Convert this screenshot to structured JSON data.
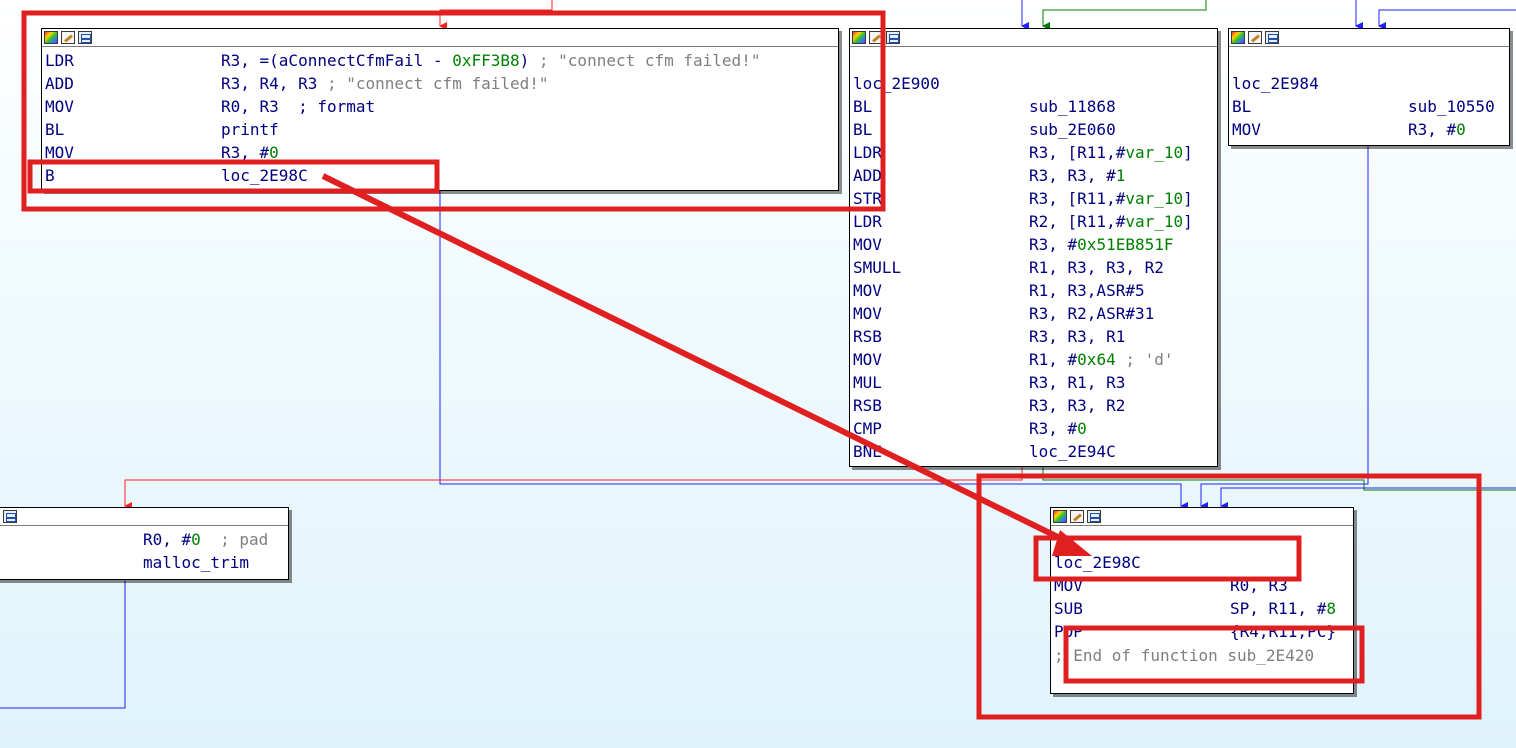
{
  "colors": {
    "mnemonic": "#000080",
    "immediate": "#008000",
    "comment": "#7f7f7f",
    "edge_true": "#008000",
    "edge_false": "#ff2020",
    "edge_normal": "#2020ff",
    "annotation": "#e02020"
  },
  "header_icons": [
    "colors-icon",
    "edit-icon",
    "graph-icon"
  ],
  "node_a": {
    "lines": [
      {
        "mn": "LDR",
        "op": "R3, =(aConnectCfmFail - ",
        "imm": "0xFF3B8",
        "tail": ")",
        "cm": " ; \"connect cfm failed!\""
      },
      {
        "mn": "ADD",
        "op": "R3, R4, R3",
        "cm": " ; \"connect cfm failed!\""
      },
      {
        "mn": "MOV",
        "op": "R0, R3  ; format"
      },
      {
        "mn": "BL",
        "op": "printf"
      },
      {
        "mn": "MOV",
        "op": "R3, #",
        "imm": "0"
      },
      {
        "mn": "B",
        "op": "loc_2E98C"
      }
    ]
  },
  "node_b": {
    "label": "loc_2E900",
    "lines": [
      {
        "mn": "BL",
        "op": "sub_11868"
      },
      {
        "mn": "BL",
        "op": "sub_2E060"
      },
      {
        "mn": "LDR",
        "op": "R3, [R11,#",
        "imm": "var_10",
        "tail": "]"
      },
      {
        "mn": "ADD",
        "op": "R3, R3, #",
        "imm": "1"
      },
      {
        "mn": "STR",
        "op": "R3, [R11,#",
        "imm": "var_10",
        "tail": "]"
      },
      {
        "mn": "LDR",
        "op": "R2, [R11,#",
        "imm": "var_10",
        "tail": "]"
      },
      {
        "mn": "MOV",
        "op": "R3, #",
        "imm": "0x51EB851F"
      },
      {
        "mn": "SMULL",
        "op": "R1, R3, R3, R2"
      },
      {
        "mn": "MOV",
        "op": "R1, R3,ASR#5"
      },
      {
        "mn": "MOV",
        "op": "R3, R2,ASR#31"
      },
      {
        "mn": "RSB",
        "op": "R3, R3, R1"
      },
      {
        "mn": "MOV",
        "op": "R1, #",
        "imm": "0x64",
        "cm": " ; 'd'"
      },
      {
        "mn": "MUL",
        "op": "R3, R1, R3"
      },
      {
        "mn": "RSB",
        "op": "R3, R3, R2"
      },
      {
        "mn": "CMP",
        "op": "R3, #",
        "imm": "0"
      },
      {
        "mn": "BNE",
        "op": "loc_2E94C"
      }
    ]
  },
  "node_c": {
    "label": "loc_2E984",
    "lines": [
      {
        "mn": "BL",
        "op": "sub_10550"
      },
      {
        "mn": "MOV",
        "op": "R3, #",
        "imm": "0"
      }
    ]
  },
  "node_d": {
    "lines": [
      {
        "mn": "",
        "op": "R0, #",
        "imm": "0",
        "cm": "  ; pad"
      },
      {
        "mn": "",
        "op": "malloc_trim"
      }
    ]
  },
  "node_e": {
    "label": "loc_2E98C",
    "lines": [
      {
        "mn": "MOV",
        "op": "R0, R3"
      },
      {
        "mn": "SUB",
        "op": "SP, R11, #",
        "imm": "8"
      },
      {
        "mn": "POP",
        "op": "{R4,R11,PC}"
      }
    ],
    "end_comment": "; End of function sub_2E420"
  }
}
